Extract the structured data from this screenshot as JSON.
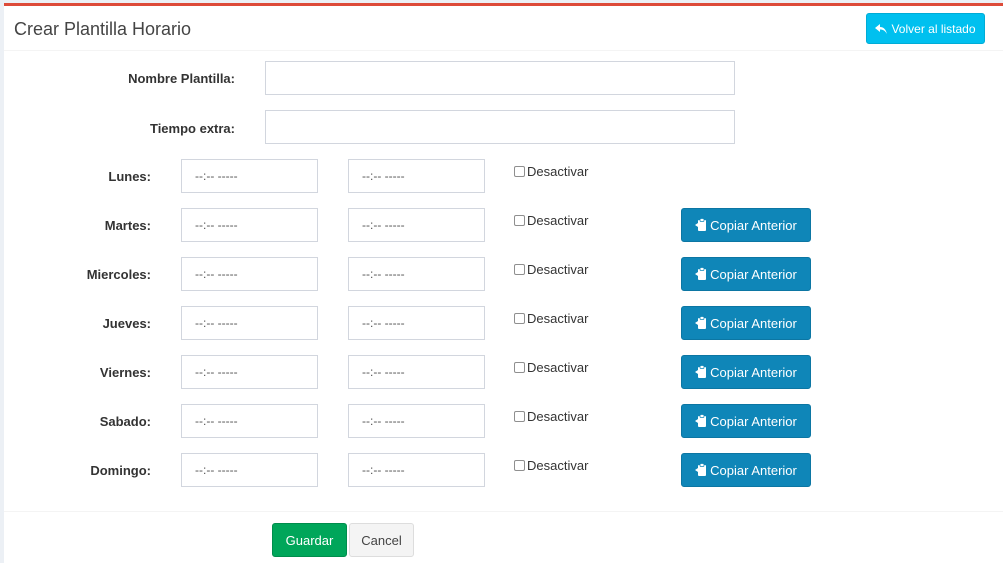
{
  "header": {
    "title": "Crear Plantilla Horario",
    "back_label": "Volver al listado"
  },
  "form": {
    "nombre_label": "Nombre Plantilla:",
    "nombre_value": "",
    "tiempo_label": "Tiempo extra:",
    "tiempo_value": ""
  },
  "schedule": {
    "time_placeholder": "--:-- -----",
    "disable_label": "Desactivar",
    "copy_label": "Copiar Anterior",
    "days": [
      {
        "label": "Lunes:"
      },
      {
        "label": "Martes:"
      },
      {
        "label": "Miercoles:"
      },
      {
        "label": "Jueves:"
      },
      {
        "label": "Viernes:"
      },
      {
        "label": "Sabado:"
      },
      {
        "label": "Domingo:"
      }
    ]
  },
  "actions": {
    "save_label": "Guardar",
    "cancel_label": "Cancel"
  },
  "colors": {
    "accent_top_border": "#dd4b39",
    "back_button": "#00c0ef",
    "copy_button": "#0f86b8",
    "save_button": "#00a65a"
  },
  "icons": {
    "back": "reply-icon",
    "copy": "copy-icon"
  }
}
